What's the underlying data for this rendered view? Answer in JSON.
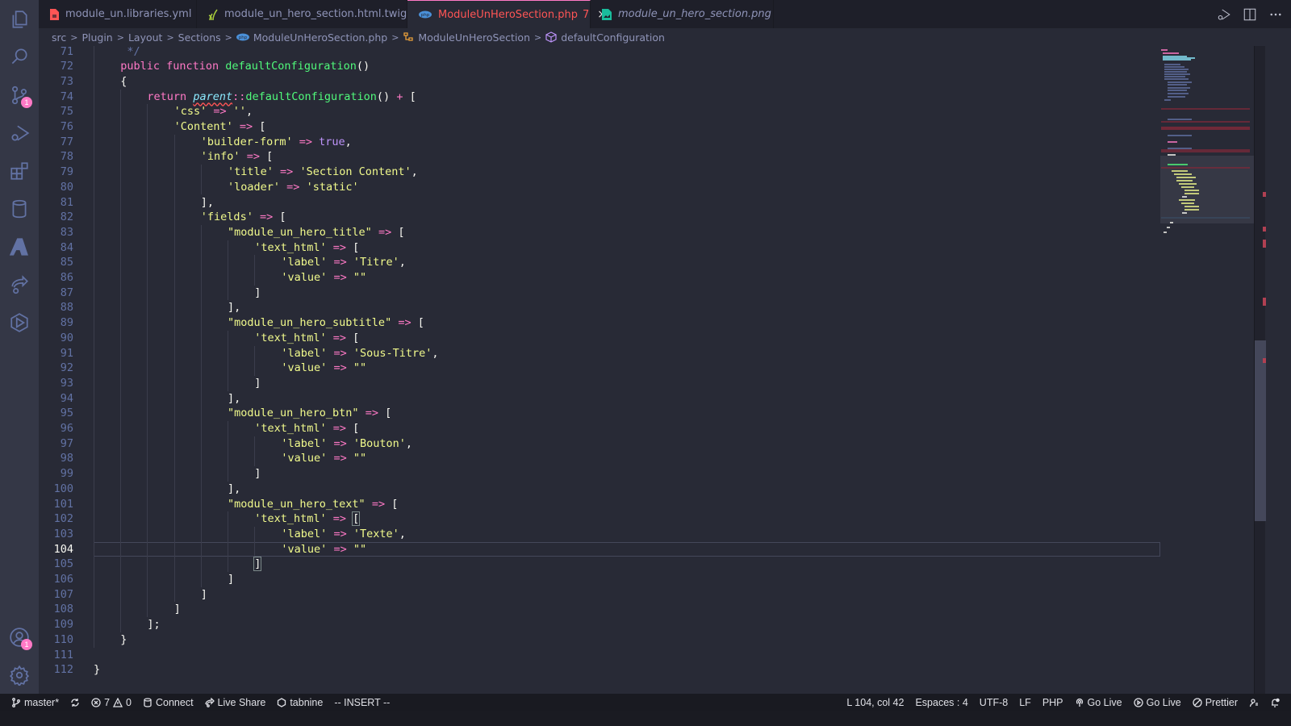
{
  "activity_bar": {
    "items": [
      {
        "name": "explorer",
        "icon": "files-icon"
      },
      {
        "name": "search",
        "icon": "search-icon"
      },
      {
        "name": "source-control",
        "icon": "source-control-icon",
        "badge": "1"
      },
      {
        "name": "run-debug",
        "icon": "run-debug-icon"
      },
      {
        "name": "extensions",
        "icon": "extensions-icon"
      },
      {
        "name": "database",
        "icon": "database-icon"
      },
      {
        "name": "azure",
        "icon": "azure-icon"
      },
      {
        "name": "live-share",
        "icon": "live-share-icon"
      },
      {
        "name": "remote",
        "icon": "hexagon-play-icon"
      }
    ],
    "accounts_badge": "1"
  },
  "tabs": [
    {
      "label": "module_un.libraries.yml",
      "icon": "yaml-file-icon",
      "active": false,
      "italic": false
    },
    {
      "label": "module_un_hero_section.html.twig",
      "icon": "twig-file-icon",
      "active": false,
      "italic": false
    },
    {
      "label": "ModuleUnHeroSection.php",
      "icon": "php-file-icon",
      "active": true,
      "italic": false,
      "problems": "7",
      "close": "×"
    },
    {
      "label": "module_un_hero_section.png",
      "icon": "image-file-icon",
      "active": false,
      "italic": true
    }
  ],
  "breadcrumb": {
    "items": [
      "src",
      "Plugin",
      "Layout",
      "Sections",
      "ModuleUnHeroSection.php",
      "ModuleUnHeroSection",
      "defaultConfiguration"
    ],
    "separator": ">"
  },
  "editor": {
    "current_line": 104,
    "lines": [
      {
        "n": "71",
        "indent": 1,
        "html": "<span class='cmt'> */</span>"
      },
      {
        "n": "72",
        "indent": 1,
        "html": "<span class='kw'>public</span> <span class='kw'>function</span> <span class='fn'>defaultConfiguration</span>()"
      },
      {
        "n": "73",
        "indent": 1,
        "html": "{"
      },
      {
        "n": "74",
        "indent": 2,
        "html": "<span class='kw'>return</span> <span class='par'>parent</span><span class='op'>::</span><span class='fn'>defaultConfiguration</span>() <span class='op'>+</span> ["
      },
      {
        "n": "75",
        "indent": 3,
        "html": "<span class='str'>'css'</span> <span class='op'>=&gt;</span> <span class='str'>''</span>,"
      },
      {
        "n": "76",
        "indent": 3,
        "html": "<span class='str'>'Content'</span> <span class='op'>=&gt;</span> ["
      },
      {
        "n": "77",
        "indent": 4,
        "html": "<span class='str'>'builder-form'</span> <span class='op'>=&gt;</span> <span class='bool'>true</span>,"
      },
      {
        "n": "78",
        "indent": 4,
        "html": "<span class='str'>'info'</span> <span class='op'>=&gt;</span> ["
      },
      {
        "n": "79",
        "indent": 5,
        "html": "<span class='str'>'title'</span> <span class='op'>=&gt;</span> <span class='str'>'Section Content'</span>,"
      },
      {
        "n": "80",
        "indent": 5,
        "html": "<span class='str'>'loader'</span> <span class='op'>=&gt;</span> <span class='str'>'static'</span>"
      },
      {
        "n": "81",
        "indent": 4,
        "html": "],"
      },
      {
        "n": "82",
        "indent": 4,
        "html": "<span class='str'>'fields'</span> <span class='op'>=&gt;</span> ["
      },
      {
        "n": "83",
        "indent": 5,
        "html": "<span class='str'>\"module_un_hero_title\"</span> <span class='op'>=&gt;</span> ["
      },
      {
        "n": "84",
        "indent": 6,
        "html": "<span class='str'>'text_html'</span> <span class='op'>=&gt;</span> ["
      },
      {
        "n": "85",
        "indent": 7,
        "html": "<span class='str'>'label'</span> <span class='op'>=&gt;</span> <span class='str'>'Titre'</span>,"
      },
      {
        "n": "86",
        "indent": 7,
        "html": "<span class='str'>'value'</span> <span class='op'>=&gt;</span> <span class='str'>\"\"</span>"
      },
      {
        "n": "87",
        "indent": 6,
        "html": "]"
      },
      {
        "n": "88",
        "indent": 5,
        "html": "],"
      },
      {
        "n": "89",
        "indent": 5,
        "html": "<span class='str'>\"module_un_hero_subtitle\"</span> <span class='op'>=&gt;</span> ["
      },
      {
        "n": "90",
        "indent": 6,
        "html": "<span class='str'>'text_html'</span> <span class='op'>=&gt;</span> ["
      },
      {
        "n": "91",
        "indent": 7,
        "html": "<span class='str'>'label'</span> <span class='op'>=&gt;</span> <span class='str'>'Sous-Titre'</span>,"
      },
      {
        "n": "92",
        "indent": 7,
        "html": "<span class='str'>'value'</span> <span class='op'>=&gt;</span> <span class='str'>\"\"</span>"
      },
      {
        "n": "93",
        "indent": 6,
        "html": "]"
      },
      {
        "n": "94",
        "indent": 5,
        "html": "],"
      },
      {
        "n": "95",
        "indent": 5,
        "html": "<span class='str'>\"module_un_hero_btn\"</span> <span class='op'>=&gt;</span> ["
      },
      {
        "n": "96",
        "indent": 6,
        "html": "<span class='str'>'text_html'</span> <span class='op'>=&gt;</span> ["
      },
      {
        "n": "97",
        "indent": 7,
        "html": "<span class='str'>'label'</span> <span class='op'>=&gt;</span> <span class='str'>'Bouton'</span>,"
      },
      {
        "n": "98",
        "indent": 7,
        "html": "<span class='str'>'value'</span> <span class='op'>=&gt;</span> <span class='str'>\"\"</span>"
      },
      {
        "n": "99",
        "indent": 6,
        "html": "]"
      },
      {
        "n": "100",
        "indent": 5,
        "html": "],"
      },
      {
        "n": "101",
        "indent": 5,
        "html": "<span class='str'>\"module_un_hero_text\"</span> <span class='op'>=&gt;</span> ["
      },
      {
        "n": "102",
        "indent": 6,
        "html": "<span class='str'>'text_html'</span> <span class='op'>=&gt;</span> <span class='bracket-match'>[</span>"
      },
      {
        "n": "103",
        "indent": 7,
        "html": "<span class='str'>'label'</span> <span class='op'>=&gt;</span> <span class='str'>'Texte'</span>,"
      },
      {
        "n": "104",
        "indent": 7,
        "html": "<span class='str'>'value'</span> <span class='op'>=&gt;</span> <span class='str'>\"\"</span>"
      },
      {
        "n": "105",
        "indent": 6,
        "html": "<span class='bracket-match'>]</span>"
      },
      {
        "n": "106",
        "indent": 5,
        "html": "]"
      },
      {
        "n": "107",
        "indent": 4,
        "html": "]"
      },
      {
        "n": "108",
        "indent": 3,
        "html": "]"
      },
      {
        "n": "109",
        "indent": 2,
        "html": "];"
      },
      {
        "n": "110",
        "indent": 1,
        "html": "}"
      },
      {
        "n": "111",
        "indent": 0,
        "html": ""
      },
      {
        "n": "112",
        "indent": 0,
        "html": "}"
      }
    ]
  },
  "status_bar": {
    "branch": "master*",
    "errors": "7",
    "warnings": "0",
    "connect": "Connect",
    "live_share": "Live Share",
    "tabnine": "tabnine",
    "mode": "-- INSERT --",
    "position": "L 104, col 42",
    "spaces": "Espaces : 4",
    "encoding": "UTF-8",
    "eol": "LF",
    "language": "PHP",
    "go_live_1": "Go Live",
    "go_live_2": "Go Live",
    "prettier": "Prettier"
  }
}
